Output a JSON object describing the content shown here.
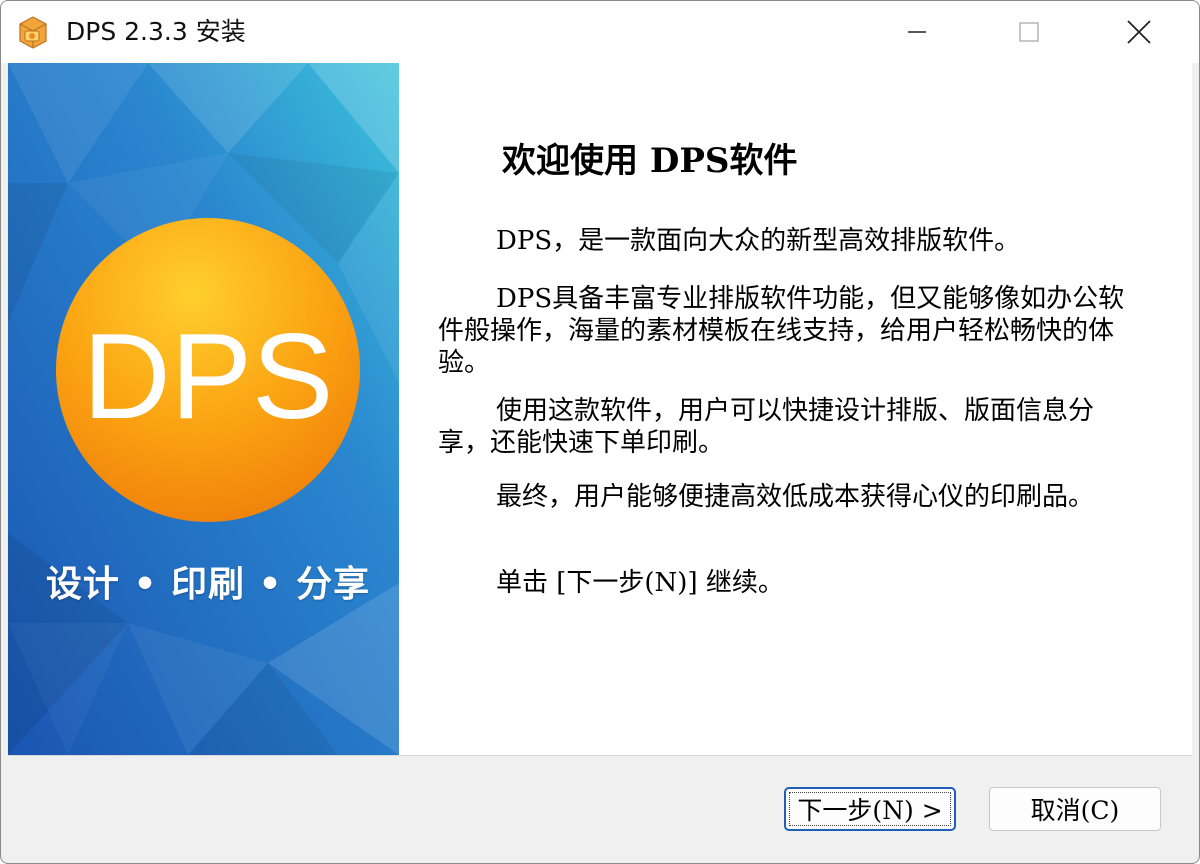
{
  "window": {
    "title": "DPS 2.3.3 安装",
    "icon": "app-box-icon",
    "controls": {
      "minimize": "minimize-icon",
      "maximize": "maximize-icon",
      "close": "close-icon"
    }
  },
  "banner": {
    "logo_text": "DPS",
    "slogan": "设计 • 印刷 • 分享",
    "colors": {
      "background_start": "#2fb3d6",
      "background_end": "#1a5db7",
      "logo_orange": "#f79a0f",
      "logo_yellow": "#ffc52a"
    }
  },
  "main": {
    "title": "欢迎使用 DPS软件",
    "paragraphs": [
      "DPS，是一款面向大众的新型高效排版软件。",
      "DPS具备丰富专业排版软件功能，但又能够像如办公软件般操作，海量的素材模板在线支持，给用户轻松畅快的体验。",
      "使用这款软件，用户可以快捷设计排版、版面信息分享，还能快速下单印刷。",
      "最终，用户能够便捷高效低成本获得心仪的印刷品。",
      "单击 [下一步(N)] 继续。"
    ]
  },
  "footer": {
    "next_label": "下一步(N) >",
    "cancel_label": "取消(C)",
    "accent": "#1f5fb8"
  }
}
